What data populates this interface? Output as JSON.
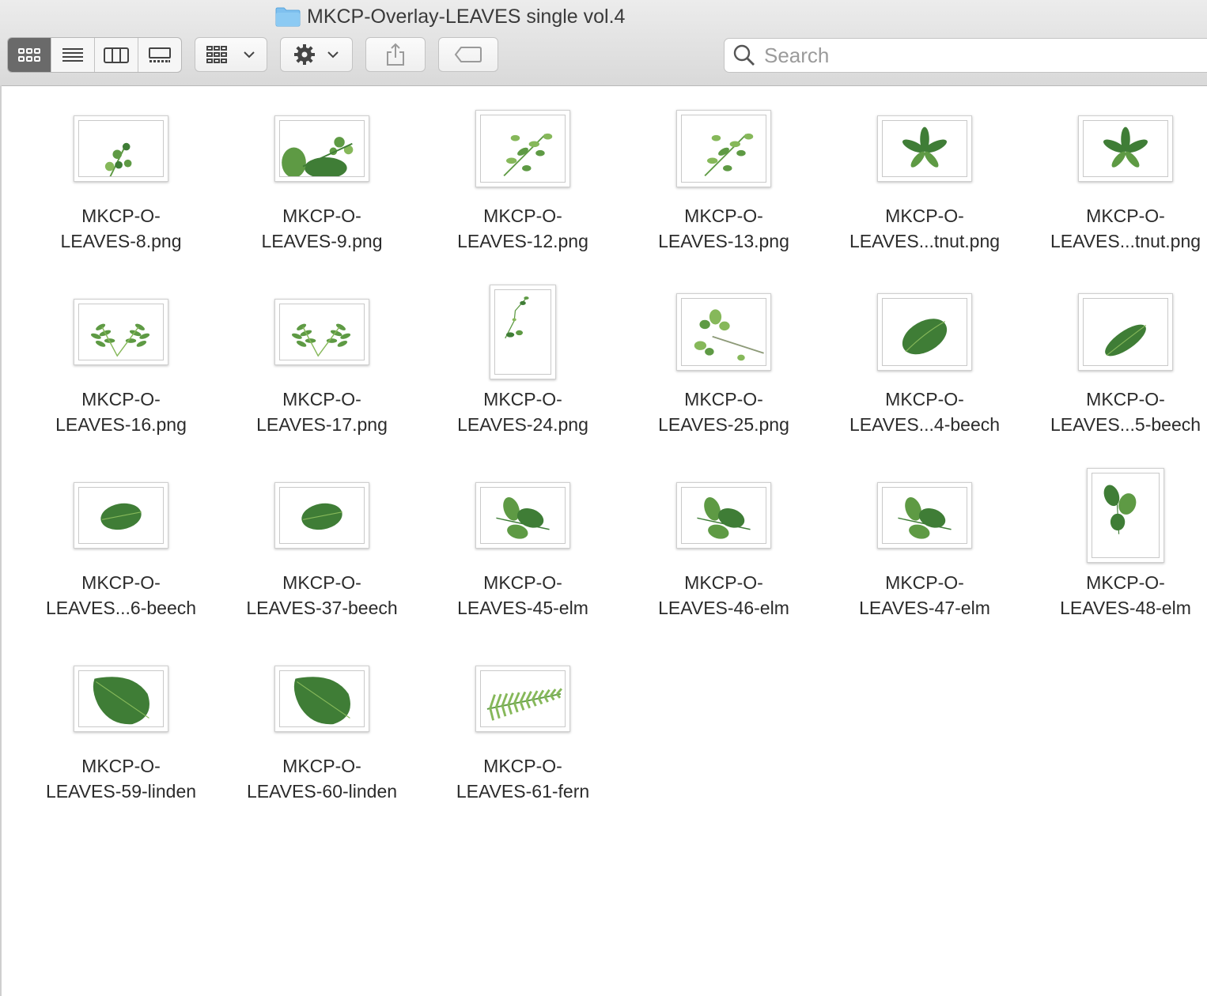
{
  "window": {
    "title": "MKCP-Overlay-LEAVES single vol.4"
  },
  "toolbar": {
    "view_modes": [
      "icon-view",
      "list-view",
      "column-view",
      "gallery-view"
    ],
    "group_button": "group-icon",
    "action_button": "gear-icon",
    "share_button": "share-icon",
    "tags_button": "tag-icon",
    "search_placeholder": "Search",
    "accent_color": "#6a6a6a"
  },
  "files": [
    {
      "line1": "MKCP-O-",
      "line2": "LEAVES-8.png",
      "art": "berries",
      "shape": "wide"
    },
    {
      "line1": "MKCP-O-",
      "line2": "LEAVES-9.png",
      "art": "berrybig",
      "shape": "wide"
    },
    {
      "line1": "MKCP-O-",
      "line2": "LEAVES-12.png",
      "art": "sprig",
      "shape": "mid"
    },
    {
      "line1": "MKCP-O-",
      "line2": "LEAVES-13.png",
      "art": "sprig",
      "shape": "mid"
    },
    {
      "line1": "MKCP-O-",
      "line2": "LEAVES...tnut.png",
      "art": "chestnut",
      "shape": "wide"
    },
    {
      "line1": "MKCP-O-",
      "line2": "LEAVES...tnut.png",
      "art": "chestnut",
      "shape": "wide"
    },
    {
      "line1": "MKCP-O-",
      "line2": "LEAVES-16.png",
      "art": "pinnate",
      "shape": "wide"
    },
    {
      "line1": "MKCP-O-",
      "line2": "LEAVES-17.png",
      "art": "pinnate",
      "shape": "wide"
    },
    {
      "line1": "MKCP-O-",
      "line2": "LEAVES-24.png",
      "art": "vine",
      "shape": "tall"
    },
    {
      "line1": "MKCP-O-",
      "line2": "LEAVES-25.png",
      "art": "branch",
      "shape": "mid"
    },
    {
      "line1": "MKCP-O-",
      "line2": "LEAVES...4-beech",
      "art": "beechbig",
      "shape": "mid"
    },
    {
      "line1": "MKCP-O-",
      "line2": "LEAVES...5-beech",
      "art": "beechslim",
      "shape": "mid"
    },
    {
      "line1": "MKCP-O-",
      "line2": "LEAVES...6-beech",
      "art": "oval",
      "shape": "wide"
    },
    {
      "line1": "MKCP-O-",
      "line2": "LEAVES-37-beech",
      "art": "oval",
      "shape": "wide"
    },
    {
      "line1": "MKCP-O-",
      "line2": "LEAVES-45-elm",
      "art": "elm",
      "shape": "wide"
    },
    {
      "line1": "MKCP-O-",
      "line2": "LEAVES-46-elm",
      "art": "elm",
      "shape": "wide"
    },
    {
      "line1": "MKCP-O-",
      "line2": "LEAVES-47-elm",
      "art": "elm",
      "shape": "wide"
    },
    {
      "line1": "MKCP-O-",
      "line2": "LEAVES-48-elm",
      "art": "elmtall",
      "shape": "tall2"
    },
    {
      "line1": "MKCP-O-",
      "line2": "LEAVES-59-linden",
      "art": "linden",
      "shape": "wide"
    },
    {
      "line1": "MKCP-O-",
      "line2": "LEAVES-60-linden",
      "art": "linden",
      "shape": "wide"
    },
    {
      "line1": "MKCP-O-",
      "line2": "LEAVES-61-fern",
      "art": "fern",
      "shape": "wide"
    }
  ]
}
